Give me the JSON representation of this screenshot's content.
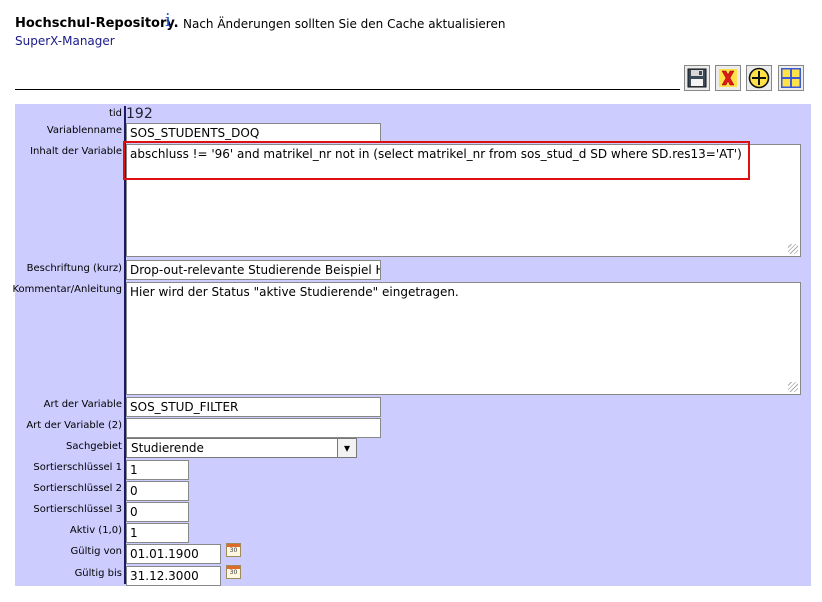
{
  "header": {
    "title": "Hochschul-Repository.",
    "subtitle": "SuperX-Manager",
    "info_icon": "i",
    "message": "Nach Änderungen sollten Sie den Cache aktualisieren"
  },
  "toolbar": {
    "save_icon": "save-icon",
    "delete_icon": "delete-icon",
    "add_icon": "add-icon",
    "grid_icon": "grid-icon"
  },
  "form": {
    "tid_label": "tid",
    "tid_value": "192",
    "variablenname_label": "Variablenname",
    "variablenname_value": "SOS_STUDENTS_DOQ",
    "inhalt_label": "Inhalt der Variable",
    "inhalt_value": "abschluss != '96' and matrikel_nr not in (select matrikel_nr from sos_stud_d SD where SD.res13='AT')",
    "beschriftung_label": "Beschriftung (kurz)",
    "beschriftung_value": "Drop-out-relevante Studierende Beispiel Hei",
    "kommentar_label": "Kommentar/Anleitung",
    "kommentar_value": "Hier wird der Status \"aktive Studierende\" eingetragen.",
    "art_label": "Art der Variable",
    "art_value": "SOS_STUD_FILTER",
    "art2_label": "Art der Variable (2)",
    "art2_value": "",
    "sachgebiet_label": "Sachgebiet",
    "sachgebiet_value": "Studierende",
    "sort1_label": "Sortierschlüssel 1",
    "sort1_value": "1",
    "sort2_label": "Sortierschlüssel 2",
    "sort2_value": "0",
    "sort3_label": "Sortierschlüssel 3",
    "sort3_value": "0",
    "aktiv_label": "Aktiv (1,0)",
    "aktiv_value": "1",
    "gueltig_von_label": "Gültig von",
    "gueltig_von_value": "01.01.1900",
    "gueltig_bis_label": "Gültig bis",
    "gueltig_bis_value": "31.12.3000",
    "calendar_icon_text": "30"
  },
  "colors": {
    "panel_bg": "#ccccff",
    "highlight_border": "#e01010",
    "link_blue": "#1a1a8a"
  }
}
